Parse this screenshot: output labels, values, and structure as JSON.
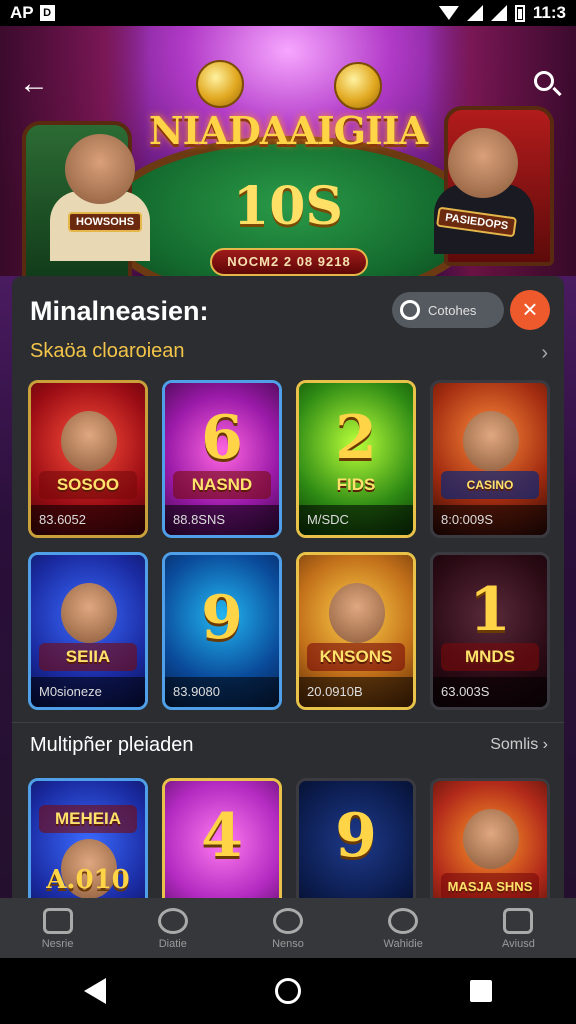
{
  "status": {
    "carrier": "AP",
    "time": "11:3"
  },
  "hero": {
    "title": "NIADAAIGIIA",
    "amount": "10S",
    "pill": "NOCM2 2 08 9218",
    "left_plate": "HOWSOHS",
    "right_plate": "PASIEDOPS"
  },
  "panel": {
    "title": "Minalneasien:",
    "toggle_label": "Cotohes",
    "subsection": "Skaöa cloaroiean"
  },
  "featured_games": [
    {
      "big": "",
      "banner": "SOSOO",
      "caption": "83.6052"
    },
    {
      "big": "6",
      "banner": "NASND",
      "caption": "88.8SNS"
    },
    {
      "big": "2",
      "banner": "FIDS",
      "caption": "M/SDC"
    },
    {
      "big": "",
      "banner": "CASINO",
      "caption": "8:0:009S"
    },
    {
      "big": "",
      "banner": "SEIIA",
      "caption": "M0sioneze"
    },
    {
      "big": "9",
      "banner": "",
      "caption": "83.9080"
    },
    {
      "big": "",
      "banner": "KNSONS",
      "caption": "20.0910B"
    },
    {
      "big": "1",
      "banner": "MNDS",
      "caption": "63.003S"
    }
  ],
  "multiplayer": {
    "title": "Multipñer pleiaden",
    "see_all": "Somlis",
    "games": [
      {
        "big": "",
        "banner": "MEHEIA",
        "caption": "A.010"
      },
      {
        "big": "4",
        "banner": "",
        "caption": ""
      },
      {
        "big": "9",
        "banner": "",
        "caption": ""
      },
      {
        "big": "",
        "banner": "MASJA SHNS",
        "caption": ""
      }
    ]
  },
  "nav": [
    {
      "label": "Nesrie",
      "icon": "home-icon"
    },
    {
      "label": "Diatie",
      "icon": "chat-icon"
    },
    {
      "label": "Nenso",
      "icon": "search-icon"
    },
    {
      "label": "Wahidie",
      "icon": "settings-icon"
    },
    {
      "label": "Aviusd",
      "icon": "folder-icon"
    }
  ]
}
